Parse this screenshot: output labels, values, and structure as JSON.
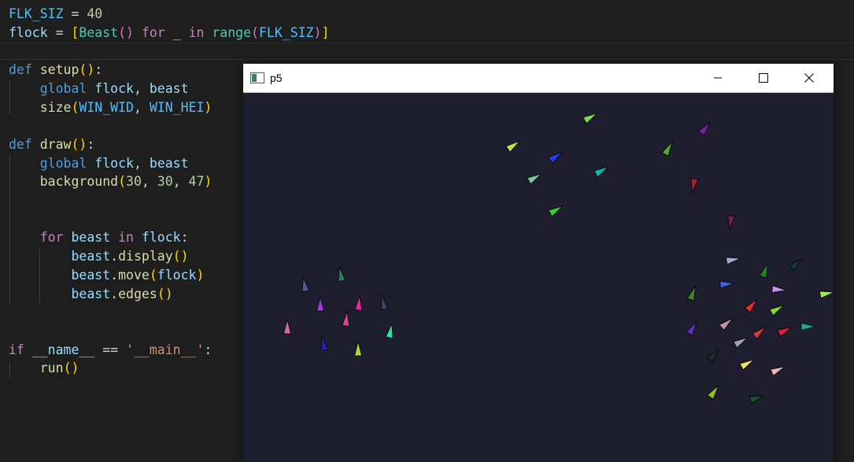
{
  "editor": {
    "lines": [
      [
        [
          "t-const",
          "FLK_SIZ"
        ],
        [
          "t-op",
          " = "
        ],
        [
          "t-num",
          "40"
        ]
      ],
      [
        [
          "t-var",
          "flock"
        ],
        [
          "t-op",
          " = "
        ],
        [
          "t-b1",
          "["
        ],
        [
          "t-cls",
          "Beast"
        ],
        [
          "t-b2",
          "()"
        ],
        [
          "t-op",
          " "
        ],
        [
          "t-ctl",
          "for"
        ],
        [
          "t-op",
          " "
        ],
        [
          "t-var",
          "_"
        ],
        [
          "t-op",
          " "
        ],
        [
          "t-ctl",
          "in"
        ],
        [
          "t-op",
          " "
        ],
        [
          "t-cls",
          "range"
        ],
        [
          "t-b2",
          "("
        ],
        [
          "t-const",
          "FLK_SIZ"
        ],
        [
          "t-b2",
          ")"
        ],
        [
          "t-b1",
          "]"
        ]
      ],
      [],
      [
        [
          "t-kw",
          "def"
        ],
        [
          "t-op",
          " "
        ],
        [
          "t-fn",
          "setup"
        ],
        [
          "t-b1",
          "()"
        ],
        [
          "t-op",
          ":"
        ]
      ],
      [
        [
          "t-op",
          "    "
        ],
        [
          "t-kw",
          "global"
        ],
        [
          "t-op",
          " "
        ],
        [
          "t-var",
          "flock"
        ],
        [
          "t-op",
          ", "
        ],
        [
          "t-var",
          "beast"
        ]
      ],
      [
        [
          "t-op",
          "    "
        ],
        [
          "t-fn",
          "size"
        ],
        [
          "t-b1",
          "("
        ],
        [
          "t-const",
          "WIN_WID"
        ],
        [
          "t-op",
          ", "
        ],
        [
          "t-const",
          "WIN_HEI"
        ],
        [
          "t-b1",
          ")"
        ]
      ],
      [],
      [
        [
          "t-kw",
          "def"
        ],
        [
          "t-op",
          " "
        ],
        [
          "t-fn",
          "draw"
        ],
        [
          "t-b1",
          "()"
        ],
        [
          "t-op",
          ":"
        ]
      ],
      [
        [
          "t-op",
          "    "
        ],
        [
          "t-kw",
          "global"
        ],
        [
          "t-op",
          " "
        ],
        [
          "t-var",
          "flock"
        ],
        [
          "t-op",
          ", "
        ],
        [
          "t-var",
          "beast"
        ]
      ],
      [
        [
          "t-op",
          "    "
        ],
        [
          "t-fn",
          "background"
        ],
        [
          "t-b1",
          "("
        ],
        [
          "t-num",
          "30"
        ],
        [
          "t-op",
          ", "
        ],
        [
          "t-num",
          "30"
        ],
        [
          "t-op",
          ", "
        ],
        [
          "t-num",
          "47"
        ],
        [
          "t-b1",
          ")"
        ]
      ],
      [],
      [],
      [
        [
          "t-op",
          "    "
        ],
        [
          "t-ctl",
          "for"
        ],
        [
          "t-op",
          " "
        ],
        [
          "t-var",
          "beast"
        ],
        [
          "t-op",
          " "
        ],
        [
          "t-ctl",
          "in"
        ],
        [
          "t-op",
          " "
        ],
        [
          "t-var",
          "flock"
        ],
        [
          "t-op",
          ":"
        ]
      ],
      [
        [
          "t-op",
          "        "
        ],
        [
          "t-var",
          "beast"
        ],
        [
          "t-op",
          "."
        ],
        [
          "t-fn",
          "display"
        ],
        [
          "t-b1",
          "()"
        ]
      ],
      [
        [
          "t-op",
          "        "
        ],
        [
          "t-var",
          "beast"
        ],
        [
          "t-op",
          "."
        ],
        [
          "t-fn",
          "move"
        ],
        [
          "t-b1",
          "("
        ],
        [
          "t-var",
          "flock"
        ],
        [
          "t-b1",
          ")"
        ]
      ],
      [
        [
          "t-op",
          "        "
        ],
        [
          "t-var",
          "beast"
        ],
        [
          "t-op",
          "."
        ],
        [
          "t-fn",
          "edges"
        ],
        [
          "t-b1",
          "()"
        ]
      ],
      [],
      [],
      [
        [
          "t-ctl",
          "if"
        ],
        [
          "t-op",
          " "
        ],
        [
          "t-var",
          "__name__"
        ],
        [
          "t-op",
          " == "
        ],
        [
          "t-str",
          "'__main__'"
        ],
        [
          "t-op",
          ":"
        ]
      ],
      [
        [
          "t-op",
          "    "
        ],
        [
          "t-fn",
          "run"
        ],
        [
          "t-b1",
          "()"
        ]
      ]
    ]
  },
  "window": {
    "title": "p5",
    "app_icon": "python-app-icon",
    "controls": [
      "minimize-icon",
      "maximize-icon",
      "close-icon"
    ],
    "background": "#1e1e2f"
  },
  "boids": [
    {
      "color": "#7ed957",
      "heading": -30
    },
    {
      "color": "#7a1fa2",
      "heading": -50
    },
    {
      "color": "#c8e03a",
      "heading": -35
    },
    {
      "color": "#2a3df5",
      "heading": -35
    },
    {
      "color": "#4caf24",
      "heading": -60
    },
    {
      "color": "#7ac8a0",
      "heading": -30
    },
    {
      "color": "#12b5b5",
      "heading": -30
    },
    {
      "color": "#a5202e",
      "heading": 100
    },
    {
      "color": "#2ed42a",
      "heading": -30
    },
    {
      "color": "#6e1e5c",
      "heading": 100
    },
    {
      "color": "#aaa3cf",
      "heading": -10
    },
    {
      "color": "#0d3b30",
      "heading": -40
    },
    {
      "color": "#1e8a1e",
      "heading": -70
    },
    {
      "color": "#3d62d9",
      "heading": -5
    },
    {
      "color": "#c490ea",
      "heading": 5
    },
    {
      "color": "#9ceb50",
      "heading": -10
    },
    {
      "color": "#3a8a23",
      "heading": -70
    },
    {
      "color": "#e82c2c",
      "heading": -50
    },
    {
      "color": "#8bd630",
      "heading": -30
    },
    {
      "color": "#5b2ec2",
      "heading": -60
    },
    {
      "color": "#c490a6",
      "heading": -40
    },
    {
      "color": "#d43a3a",
      "heading": -40
    },
    {
      "color": "#e01e3a",
      "heading": -25
    },
    {
      "color": "#1fa88c",
      "heading": 0
    },
    {
      "color": "#a3a0b8",
      "heading": -30
    },
    {
      "color": "#2a2a2a",
      "heading": -50
    },
    {
      "color": "#f0e060",
      "heading": -30
    },
    {
      "color": "#f0b5b0",
      "heading": -25
    },
    {
      "color": "#8bc220",
      "heading": -55
    },
    {
      "color": "#18502c",
      "heading": -15
    },
    {
      "color": "#4a5a9a",
      "heading": -100
    },
    {
      "color": "#2e7d4e",
      "heading": -100
    },
    {
      "color": "#9c3de0",
      "heading": -90
    },
    {
      "color": "#e02a9c",
      "heading": -85
    },
    {
      "color": "#3a4068",
      "heading": -100
    },
    {
      "color": "#d64a8c",
      "heading": -85
    },
    {
      "color": "#d0709e",
      "heading": -90
    },
    {
      "color": "#1ee8a6",
      "heading": -80
    },
    {
      "color": "#2a1ec0",
      "heading": -100
    },
    {
      "color": "#a8d838",
      "heading": -90
    }
  ]
}
